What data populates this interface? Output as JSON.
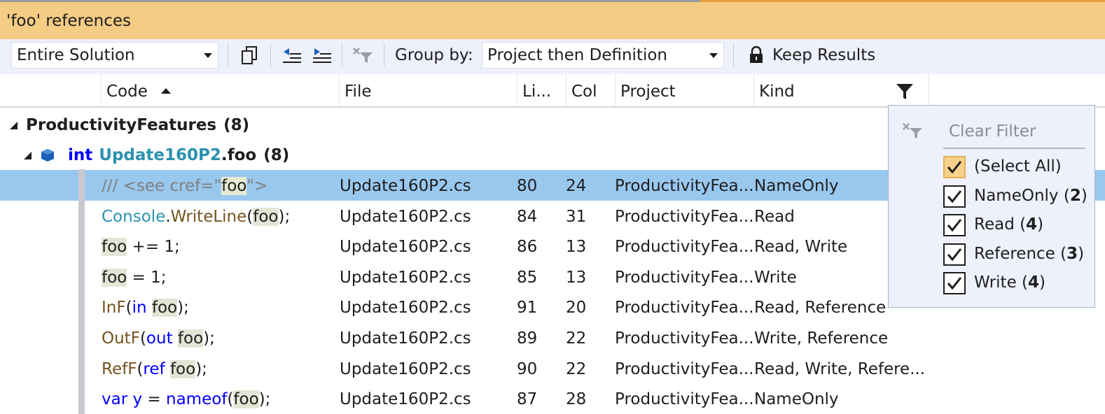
{
  "window": {
    "title": "'foo' references"
  },
  "toolbar": {
    "scope": "Entire Solution",
    "group_by_label": "Group by:",
    "group_by_value": "Project then Definition",
    "keep_results": "Keep Results"
  },
  "columns": {
    "code": "Code",
    "file": "File",
    "line": "Li...",
    "col": "Col",
    "project": "Project",
    "kind": "Kind"
  },
  "tree": {
    "project": "ProductivityFeatures",
    "project_count": "(8)",
    "definition_keyword": "int",
    "definition_type": "Update160P2",
    "definition_member": ".foo",
    "definition_count": "(8)"
  },
  "rows": [
    {
      "code_parts": [
        [
          "cm",
          "/// <see cref=\""
        ],
        [
          "hls",
          "foo"
        ],
        [
          "cm",
          "\">"
        ]
      ],
      "file": "Update160P2.cs",
      "line": "80",
      "col": "24",
      "project": "ProductivityFea...",
      "kind": "NameOnly",
      "selected": true
    },
    {
      "code_parts": [
        [
          "ty",
          "Console"
        ],
        [
          "t",
          "."
        ],
        [
          "m",
          "WriteLine"
        ],
        [
          "t",
          "("
        ],
        [
          "hl",
          "foo"
        ],
        [
          "t",
          ");"
        ]
      ],
      "file": "Update160P2.cs",
      "line": "84",
      "col": "31",
      "project": "ProductivityFea...",
      "kind": "Read"
    },
    {
      "code_parts": [
        [
          "hl",
          "foo"
        ],
        [
          "t",
          " += 1;"
        ]
      ],
      "file": "Update160P2.cs",
      "line": "86",
      "col": "13",
      "project": "ProductivityFea...",
      "kind": "Read, Write"
    },
    {
      "code_parts": [
        [
          "hl",
          "foo"
        ],
        [
          "t",
          " = 1;"
        ]
      ],
      "file": "Update160P2.cs",
      "line": "85",
      "col": "13",
      "project": "ProductivityFea...",
      "kind": "Write"
    },
    {
      "code_parts": [
        [
          "m",
          "InF"
        ],
        [
          "t",
          "("
        ],
        [
          "k",
          "in"
        ],
        [
          "t",
          " "
        ],
        [
          "hl",
          "foo"
        ],
        [
          "t",
          ");"
        ]
      ],
      "file": "Update160P2.cs",
      "line": "91",
      "col": "20",
      "project": "ProductivityFea...",
      "kind": "Read, Reference"
    },
    {
      "code_parts": [
        [
          "m",
          "OutF"
        ],
        [
          "t",
          "("
        ],
        [
          "k",
          "out"
        ],
        [
          "t",
          " "
        ],
        [
          "hl",
          "foo"
        ],
        [
          "t",
          ");"
        ]
      ],
      "file": "Update160P2.cs",
      "line": "89",
      "col": "22",
      "project": "ProductivityFea...",
      "kind": "Write, Reference"
    },
    {
      "code_parts": [
        [
          "m",
          "RefF"
        ],
        [
          "t",
          "("
        ],
        [
          "k",
          "ref"
        ],
        [
          "t",
          " "
        ],
        [
          "hl",
          "foo"
        ],
        [
          "t",
          ");"
        ]
      ],
      "file": "Update160P2.cs",
      "line": "90",
      "col": "22",
      "project": "ProductivityFea...",
      "kind": "Read, Write, Refere..."
    },
    {
      "code_parts": [
        [
          "k",
          "var"
        ],
        [
          "t",
          " "
        ],
        [
          "k",
          "y"
        ],
        [
          "t",
          " = "
        ],
        [
          "k",
          "nameof"
        ],
        [
          "t",
          "("
        ],
        [
          "hl",
          "foo"
        ],
        [
          "t",
          ");"
        ]
      ],
      "file": "Update160P2.cs",
      "line": "87",
      "col": "28",
      "project": "ProductivityFea...",
      "kind": "NameOnly"
    }
  ],
  "filter_popup": {
    "clear_filter": "Clear Filter",
    "select_all": "(Select All)",
    "options": [
      {
        "name": "NameOnly",
        "count": "2"
      },
      {
        "name": "Read",
        "count": "4"
      },
      {
        "name": "Reference",
        "count": "3"
      },
      {
        "name": "Write",
        "count": "4"
      }
    ]
  },
  "colors": {
    "title_bar": "#f5cc84",
    "toolbar": "#eef0fb",
    "selection": "#99c8ef",
    "keyword": "#0000ff",
    "type": "#2b91af",
    "method": "#74531f",
    "comment": "#808080"
  },
  "icons": [
    "copy-icon",
    "collapse-all-icon",
    "expand-all-icon",
    "clear-filter-icon",
    "lock-icon",
    "filter-funnel-icon",
    "sort-ascending-icon",
    "expand-triangle-icon",
    "field-icon",
    "checkmark-icon"
  ]
}
